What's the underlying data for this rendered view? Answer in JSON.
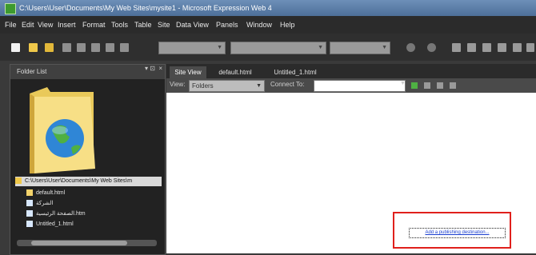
{
  "window": {
    "title": "C:\\Users\\User\\Documents\\My Web Sites\\mysite1 - Microsoft Expression Web 4"
  },
  "menu": [
    "File",
    "Edit",
    "View",
    "Insert",
    "Format",
    "Tools",
    "Table",
    "Site",
    "Data View",
    "Panels",
    "Window",
    "Help"
  ],
  "toolbar": {
    "combo1": "",
    "combo2": "",
    "combo3": "",
    "combo4": ""
  },
  "folder_panel": {
    "title": "Folder List",
    "pin": "▾ ⊡",
    "close": "×",
    "tree": [
      "C:\\Users\\User\\Documents\\My Web Sites\\m",
      "default.html",
      "الشركة",
      "الصفحة الرئيسية.htm",
      "Untitled_1.html"
    ]
  },
  "tabs": [
    "Site View",
    "default.html",
    "Untitled_1.html"
  ],
  "view_bar": {
    "view_label": "View:",
    "view_value": "Folders",
    "connect_label": "Connect To:",
    "connect_value": ""
  },
  "publish_link": "Add a publishing destination..."
}
